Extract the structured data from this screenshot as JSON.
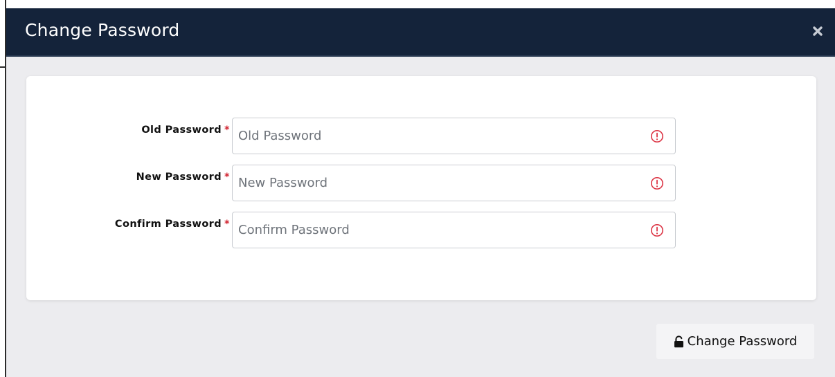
{
  "modal": {
    "title": "Change Password",
    "close_icon": "close-icon"
  },
  "form": {
    "required_marker": "*",
    "fields": [
      {
        "label": "Old Password",
        "placeholder": "Old Password",
        "value": "",
        "status_icon": "error-circle-icon"
      },
      {
        "label": "New Password",
        "placeholder": "New Password",
        "value": "",
        "status_icon": "error-circle-icon"
      },
      {
        "label": "Confirm Password",
        "placeholder": "Confirm Password",
        "value": "",
        "status_icon": "error-circle-icon"
      }
    ]
  },
  "footer": {
    "submit_label": "Change Password",
    "submit_icon": "unlock-icon"
  },
  "colors": {
    "header_bg": "#14233a",
    "required": "#d0212e",
    "error": "#dc3545",
    "modal_bg": "#ececef"
  }
}
